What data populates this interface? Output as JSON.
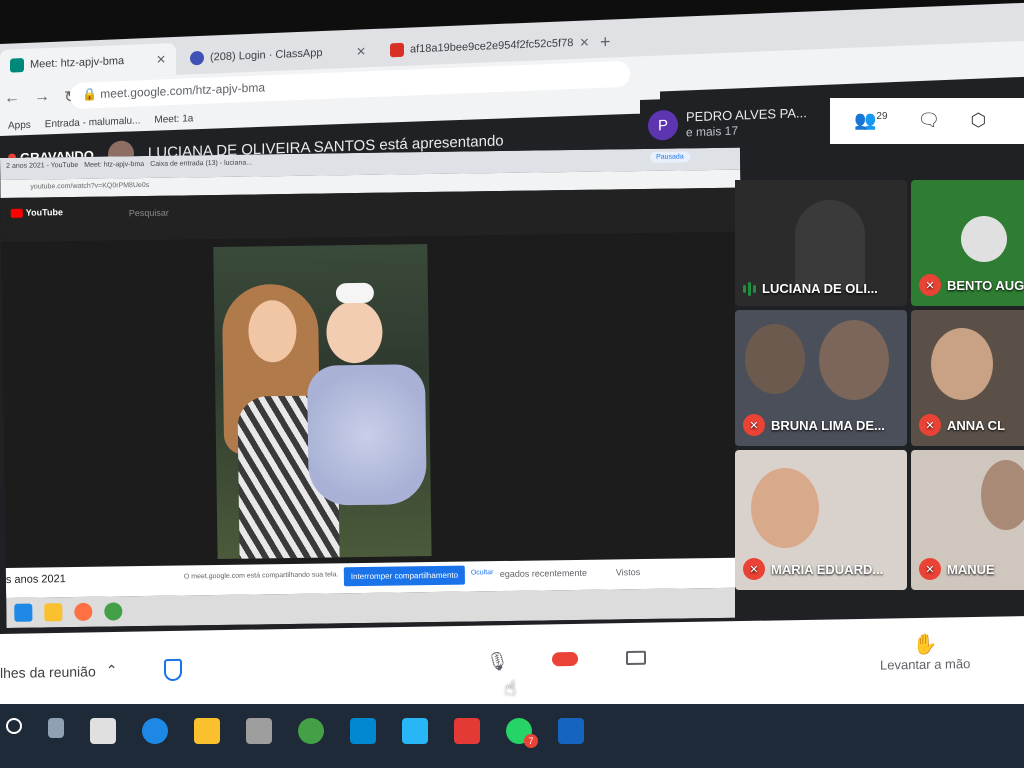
{
  "browser": {
    "tabs": [
      {
        "label": "Meet: htz-apjv-bma",
        "active": true
      },
      {
        "label": "(208) Login · ClassApp",
        "active": false
      },
      {
        "label": "af18a19bee9ce2e954f2fc52c5f78",
        "active": false
      }
    ],
    "new_tab": "+",
    "url": "meet.google.com/htz-apjv-bma",
    "bookmarks": [
      "Apps",
      "Entrada - malumalu...",
      "Meet: 1a"
    ]
  },
  "meet": {
    "recording_label": "GRAVANDO",
    "presenting_text": "LUCIANA DE OLIVEIRA SANTOS está apresentando",
    "top_participant": {
      "initial": "P",
      "name": "PEDRO ALVES PA...",
      "more": "e mais 17"
    },
    "people_count": "29",
    "participants": [
      {
        "name": "LUCIANA DE OLI...",
        "muted": false,
        "speaking": true
      },
      {
        "name": "BENTO AUG",
        "muted": true
      },
      {
        "name": "BRUNA LIMA DE...",
        "muted": true
      },
      {
        "name": "ANNA CL",
        "muted": true
      },
      {
        "name": "MARIA EDUARD...",
        "muted": true
      },
      {
        "name": "MANUE",
        "muted": true
      }
    ],
    "controls": {
      "details": "lhes da reunião",
      "raise_hand": "Levantar a mão"
    }
  },
  "shared_screen": {
    "inner_tabs": [
      "Meet: htz-apjv-bma",
      "Caixa de entrada (13) - luciana...",
      "2 anos 2021 - YouTube"
    ],
    "inner_url": "youtube.com/watch?v=KQ0rPM8Ue0s",
    "paused": "Pausada",
    "youtube_label": "YouTube",
    "search_placeholder": "Pesquisar",
    "video_title_fragment": "s anos 2021",
    "sharing_message": "O meet.google.com está compartilhando sua tela.",
    "stop_sharing": "Interromper compartilhamento",
    "hide": "Ocultar",
    "recent": "egados recentemente",
    "seen": "Vistos"
  },
  "colors": {
    "accent": "#1a73e8",
    "danger": "#ea4335",
    "meet_bg": "#202124",
    "speaking": "#1e8e3e"
  }
}
